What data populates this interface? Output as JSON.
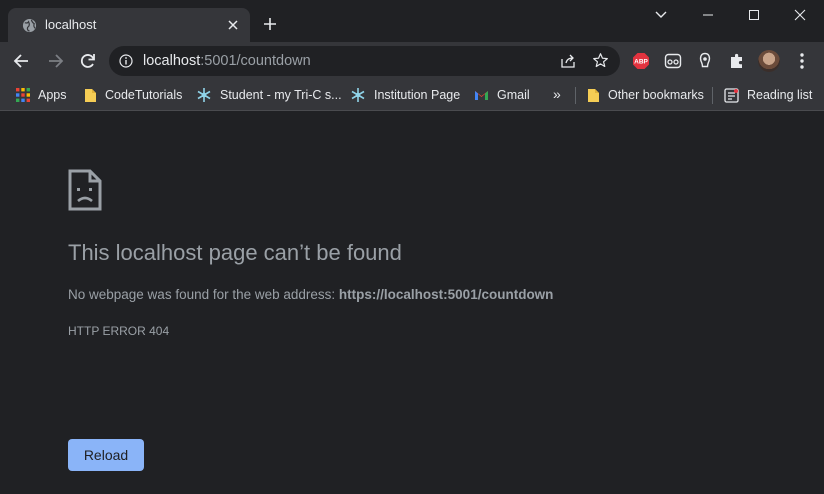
{
  "tab": {
    "title": "localhost",
    "favicon": "globe-icon"
  },
  "omnibox": {
    "host": "localhost",
    "rest": ":5001/countdown"
  },
  "bookmarks": [
    {
      "label": "Apps",
      "icon": "apps-grid-icon"
    },
    {
      "label": "CodeTutorials",
      "icon": "folder-icon"
    },
    {
      "label": "Student - my Tri-C s...",
      "icon": "snowflake-icon"
    },
    {
      "label": "Institution Page",
      "icon": "snowflake-icon"
    },
    {
      "label": "Gmail",
      "icon": "gmail-icon"
    },
    {
      "label": "Other bookmarks",
      "icon": "folder-icon"
    },
    {
      "label": "Reading list",
      "icon": "reading-list-icon"
    }
  ],
  "more_bookmarks": "»",
  "extensions": [
    {
      "name": "adblock-plus",
      "label": "ABP",
      "color": "#e2333f"
    }
  ],
  "error": {
    "title": "This localhost page can’t be found",
    "description_prefix": "No webpage was found for the web address: ",
    "description_url": "https://localhost:5001/countdown",
    "code": "HTTP ERROR 404",
    "reload_label": "Reload"
  },
  "colors": {
    "accent": "#8ab4f8",
    "background": "#202124",
    "toolbar": "#35363a"
  }
}
